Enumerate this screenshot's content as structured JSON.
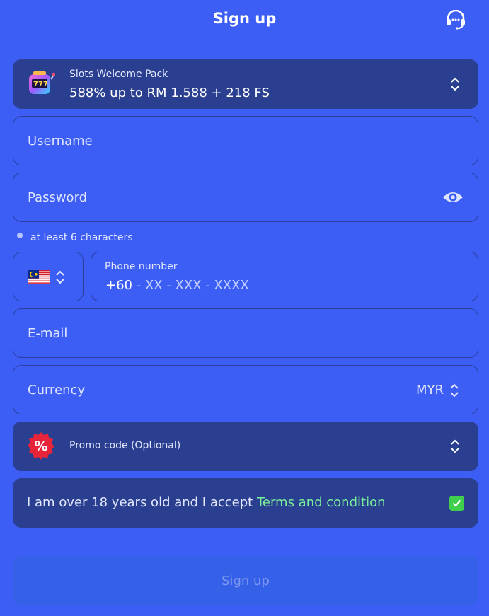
{
  "header": {
    "title": "Sign up",
    "support_icon": "headset-icon"
  },
  "bonus": {
    "title": "Slots Welcome Pack",
    "value": "588% up to RM 1.588 + 218 FS",
    "icon": "slot-machine-icon"
  },
  "form": {
    "username_label": "Username",
    "password_label": "Password",
    "password_hint": "at least 6 characters",
    "phone": {
      "country_flag": "malaysia-flag-icon",
      "label": "Phone number",
      "code": "+60",
      "mask": " - XX - XXX - XXXX"
    },
    "email_label": "E-mail",
    "currency_label": "Currency",
    "currency_value": "MYR",
    "promo_label": "Promo code (Optional)",
    "terms_text": "I am over 18 years old and I accept ",
    "terms_link": "Terms and condition",
    "terms_checked": true
  },
  "submit_label": "Sign up",
  "colors": {
    "background": "#3d5ef5",
    "panel": "#2a3f8f",
    "link": "#7bf09a",
    "checkbox": "#3fcf4d"
  }
}
